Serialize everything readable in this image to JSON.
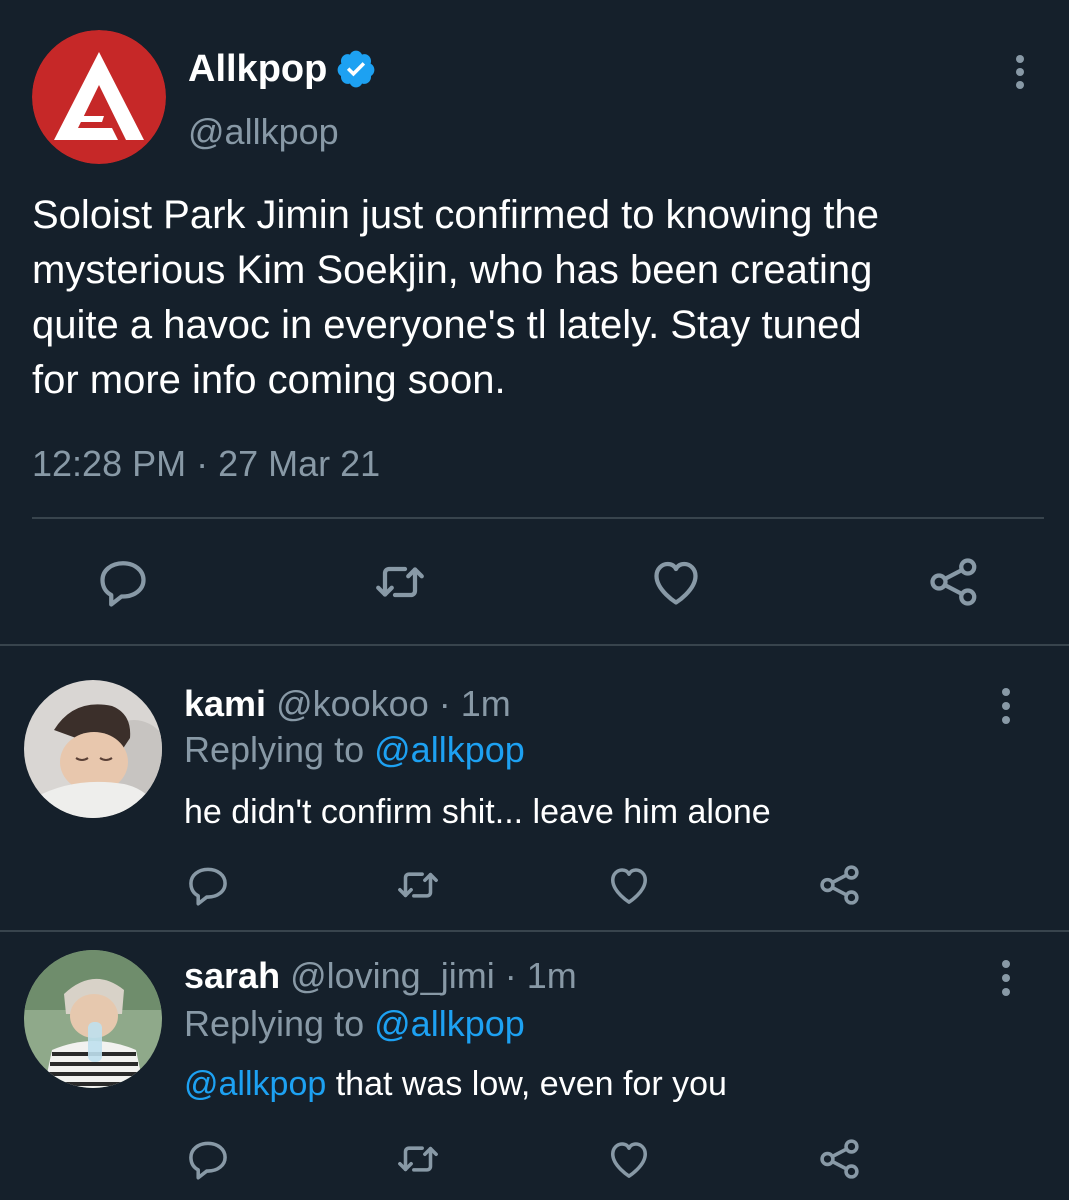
{
  "main_tweet": {
    "author_name": "Allkpop",
    "handle": "@allkpop",
    "text": "Soloist Park Jimin just confirmed to knowing the\nmysterious Kim Soekjin, who has been creating\nquite a havoc in everyone's tl lately. Stay tuned\nfor more info coming soon.",
    "timestamp": "12:28 PM · 27 Mar 21",
    "verified": true,
    "brand_color": "#c62828",
    "icons": [
      "reply-icon",
      "retweet-icon",
      "like-icon",
      "share-icon",
      "more-icon",
      "verified-badge-icon"
    ]
  },
  "replies": [
    {
      "name": "kami",
      "handle": "@kookoo",
      "sep": "·",
      "time": "1m",
      "replying_label": "Replying to",
      "replying_handle": "@allkpop",
      "mention": "",
      "text": "he didn't confirm shit... leave him alone"
    },
    {
      "name": "sarah",
      "handle": "@loving_jimi",
      "sep": "·",
      "time": "1m",
      "replying_label": "Replying to",
      "replying_handle": "@allkpop",
      "mention": "@allkpop",
      "text": " that was low, even for you"
    }
  ],
  "colors": {
    "background": "#15202b",
    "secondary_text": "#8899a6",
    "link": "#1da1f2",
    "divider": "#38444d",
    "verified": "#1da1f2"
  }
}
